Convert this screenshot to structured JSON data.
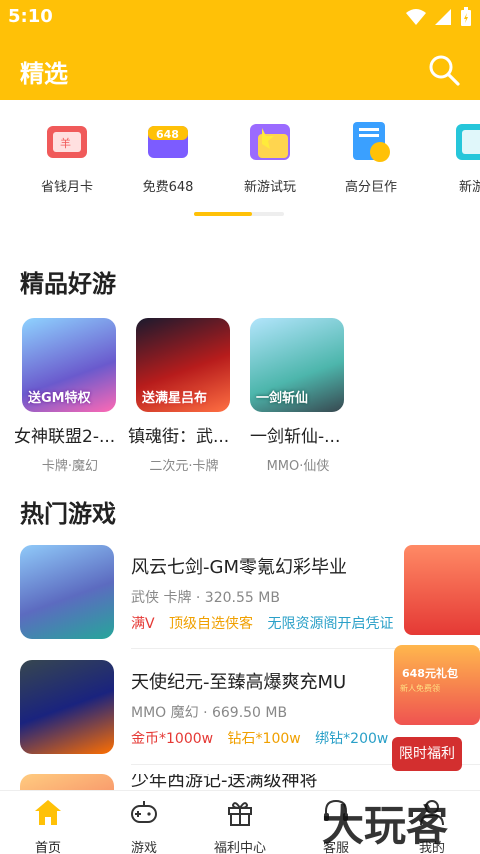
{
  "status": {
    "time": "5:10"
  },
  "header": {
    "title": "精选"
  },
  "categories": [
    {
      "label": "省钱月卡",
      "icon": "wallet-card-icon",
      "badge": "羊"
    },
    {
      "label": "免费648",
      "icon": "gift-648-icon",
      "badge": "648"
    },
    {
      "label": "新游试玩",
      "icon": "new-game-icon",
      "badge": ""
    },
    {
      "label": "高分巨作",
      "icon": "trophy-doc-icon",
      "badge": ""
    },
    {
      "label": "新游",
      "icon": "new-icon",
      "badge": ""
    }
  ],
  "featured": {
    "title": "精品好游",
    "items": [
      {
        "name": "女神联盟2-...",
        "tag": "卡牌·魔幻",
        "cover_text": "送GM特权"
      },
      {
        "name": "镇魂街：武...",
        "tag": "二次元·卡牌",
        "cover_text": "送满星吕布"
      },
      {
        "name": "一剑斩仙-...",
        "tag": "MMO·仙侠",
        "cover_text": "一剑斩仙"
      }
    ]
  },
  "hot": {
    "title": "热门游戏",
    "items": [
      {
        "name": "风云七剑-GM零氪幻彩毕业",
        "meta": "武侠 卡牌 · 320.55 MB",
        "tags": [
          {
            "text": "满V",
            "color": "#e53935"
          },
          {
            "text": "顶级自选侠客",
            "color": "#f0a000"
          },
          {
            "text": "无限资源阁开启凭证",
            "color": "#2aa0c8"
          }
        ]
      },
      {
        "name": "天使纪元-至臻高爆爽充MU",
        "meta": "MMO 魔幻 · 669.50 MB",
        "tags": [
          {
            "text": "金币*1000w",
            "color": "#e53935"
          },
          {
            "text": "钻石*100w",
            "color": "#f0a000"
          },
          {
            "text": "绑钻*200w",
            "color": "#2aa0c8"
          }
        ]
      },
      {
        "name": "少年西游记-送满级神将",
        "meta": "",
        "tags": []
      }
    ]
  },
  "promo": {
    "box_title": "648元礼包",
    "box_sub": "新人免费领",
    "caption": "限时福利"
  },
  "nav": [
    {
      "label": "首页",
      "icon": "home-icon",
      "active": true
    },
    {
      "label": "游戏",
      "icon": "gamepad-icon",
      "active": false
    },
    {
      "label": "福利中心",
      "icon": "gift-icon",
      "active": false
    },
    {
      "label": "客服",
      "icon": "headset-icon",
      "active": false
    },
    {
      "label": "我的",
      "icon": "user-icon",
      "active": false
    }
  ],
  "watermark": "大玩客",
  "colors": {
    "brand": "#FFC107",
    "red": "#e53935",
    "orange": "#f0a000",
    "blue": "#2aa0c8"
  }
}
